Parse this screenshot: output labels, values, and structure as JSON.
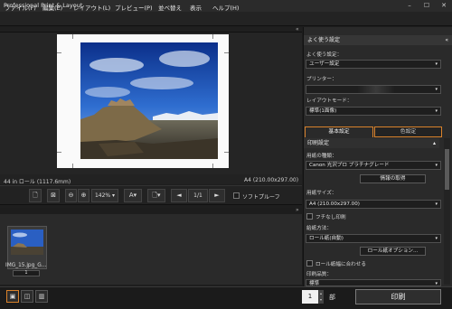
{
  "window": {
    "title": "Professional Print & Layout",
    "minimize": "–",
    "maximize": "☐",
    "close": "✕"
  },
  "menu": [
    "ファイル(F)",
    "編集(E)",
    "レイアウト(L)",
    "プレビュー(P)",
    "並べ替え",
    "表示",
    "ヘルプ(H)"
  ],
  "preview": {
    "paper_roll": "44 in ロール (1117.6mm)",
    "paper_size": "A4 (210.00x297.00)"
  },
  "toolbar": {
    "zoom_value": "142%",
    "page_counter": "1/1",
    "soft_proof_label": "ソフトプルーフ",
    "letter_a": "A",
    "prev": "◄",
    "next": "►"
  },
  "thumbnail": {
    "filename": "IMG_15.jpg_G...",
    "copies": "1"
  },
  "bottom": {
    "copies_value": "1",
    "copies_unit": "部",
    "print_button": "印刷"
  },
  "panel": {
    "section_title": "よく使う設定",
    "favorite_label": "よく使う設定：",
    "favorite_value": "ユーザー設定",
    "printer_label": "プリンター：",
    "printer_value": "",
    "layout_mode_label": "レイアウトモード：",
    "layout_mode_value": "標準(1面像)",
    "tab_basic": "基本設定",
    "tab_color": "色設定",
    "print_settings_title": "印刷設定",
    "media_type_label": "用紙の種類：",
    "media_type_value": "Canon 光沢プロ プラチナグレード",
    "get_info_button": "情報の取得",
    "paper_size_label": "用紙サイズ：",
    "paper_size_value": "A4 (210.00x297.00)",
    "borderless_label": "フチなし印刷",
    "paper_feed_label": "給紙方法：",
    "paper_feed_value": "ロール紙(自動)",
    "roll_options_button": "ロール紙オプション...",
    "fit_roll_label": "ロール紙幅に合わせる",
    "print_quality_label": "印刷品質：",
    "print_quality_value": "標準"
  },
  "colors": {
    "accent_orange": "#d9822b",
    "panel_bg": "#2a2a2a",
    "app_bg": "#1e1e1e"
  }
}
